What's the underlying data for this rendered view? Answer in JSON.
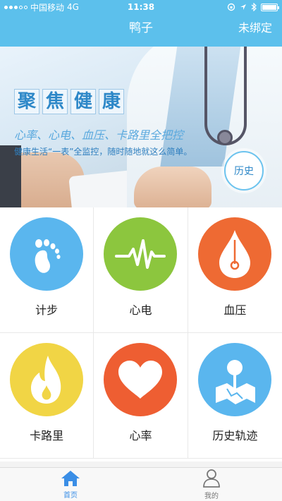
{
  "status_bar": {
    "carrier": "中国移动",
    "network": "4G",
    "time": "11:38"
  },
  "nav": {
    "title": "鸭子",
    "right_action": "未绑定"
  },
  "banner": {
    "heading_chars": [
      "聚",
      "焦",
      "健",
      "康"
    ],
    "subtitle": "心率、心电、血压、卡路里全把控",
    "description": "健康生活“一表”全监控，随时随地就这么简单。",
    "history_button": "历史",
    "page_count": 3,
    "active_page": 1
  },
  "features": [
    {
      "label": "计步",
      "icon": "footprint-icon",
      "color": "#5ab6ee"
    },
    {
      "label": "心电",
      "icon": "ecg-wave-icon",
      "color": "#8cc63e"
    },
    {
      "label": "血压",
      "icon": "pressure-drop-icon",
      "color": "#ee6a33"
    },
    {
      "label": "卡路里",
      "icon": "flame-icon",
      "color": "#f1d545"
    },
    {
      "label": "心率",
      "icon": "heart-icon",
      "color": "#ee5e32"
    },
    {
      "label": "历史轨迹",
      "icon": "map-pin-icon",
      "color": "#5ab6ee"
    }
  ],
  "tabs": [
    {
      "label": "首页",
      "active": true
    },
    {
      "label": "我的",
      "active": false
    }
  ],
  "colors": {
    "primary": "#5cc0ec",
    "tab_active": "#3a8ee6"
  }
}
